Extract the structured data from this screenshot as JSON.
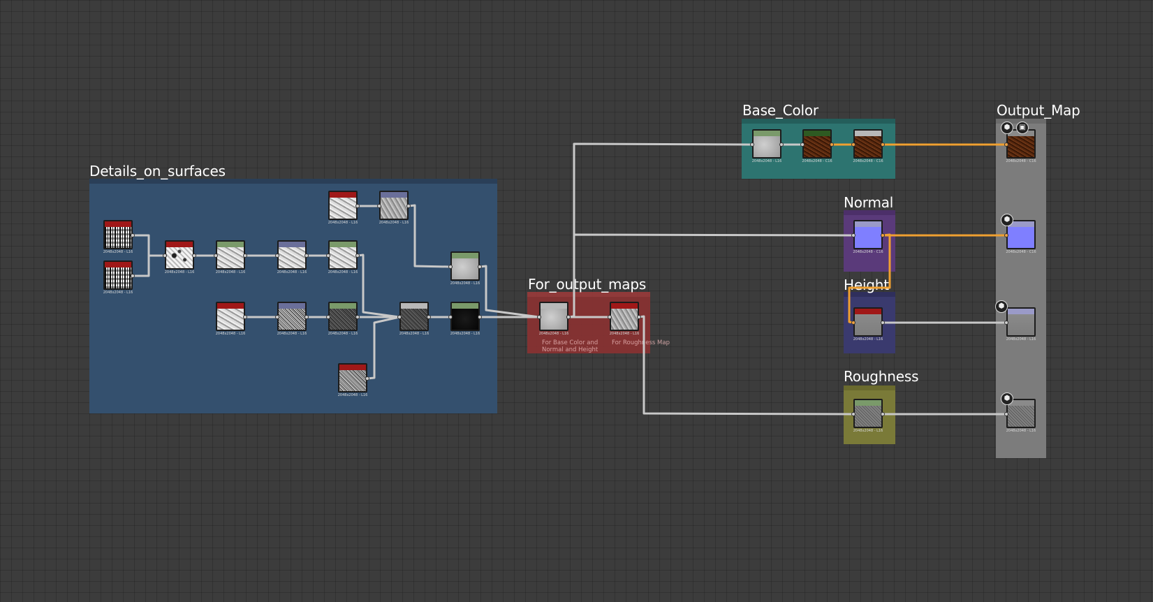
{
  "frames": {
    "details": {
      "title": "Details_on_surfaces",
      "color": "#34506e",
      "bar": "#2a3f58"
    },
    "for_output": {
      "title": "For_output_maps",
      "color": "#8b3232",
      "bar": "#9a3a3a",
      "comment_left": "For Base Color and\nNormal and Height",
      "comment_right": "For Roughness Map"
    },
    "base_color": {
      "title": "Base_Color",
      "color": "#2d7470",
      "bar": "#245e5b"
    },
    "normal": {
      "title": "Normal",
      "color": "#5a3a7a",
      "bar": "#4c2f69"
    },
    "height": {
      "title": "Height",
      "color": "#3a3a6e",
      "bar": "#2f2f5c"
    },
    "roughness": {
      "title": "Roughness",
      "color": "#7a7a38",
      "bar": "#6a6a2e"
    },
    "output": {
      "title": "Output_Map",
      "color": "#7c7c7c",
      "bar": "#6c6c6c"
    }
  },
  "header_colors": {
    "red": "#a01818",
    "green": "#7a9a6a",
    "blue": "#6a6f9a",
    "grey": "#b8b8b8",
    "darkgreen": "#2e5a22",
    "lavender": "#9a9ac8",
    "none": "#8a8a8a"
  },
  "wire_colors": {
    "default": "#c8c8c8",
    "orange": "#f0a030"
  },
  "nodes": [
    {
      "id": "n1",
      "header": "red",
      "thumb": "t-noise-bw",
      "label": "2048x2048 - L16"
    },
    {
      "id": "n2",
      "header": "red",
      "thumb": "t-noise-bw",
      "label": "2048x2048 - L16"
    },
    {
      "id": "n3",
      "header": "red",
      "thumb": "t-white-spots",
      "label": "2048x2048 - L16"
    },
    {
      "id": "n4",
      "header": "green",
      "thumb": "t-grey-light",
      "label": "2048x2048 - L16"
    },
    {
      "id": "n5",
      "header": "blue",
      "thumb": "t-grey-light",
      "label": "2048x2048 - L16"
    },
    {
      "id": "n6",
      "header": "green",
      "thumb": "t-grey-light",
      "label": "2048x2048 - L16"
    },
    {
      "id": "n7",
      "header": "red",
      "thumb": "t-grey-light",
      "label": "2048x2048 - L16"
    },
    {
      "id": "n8",
      "header": "blue",
      "thumb": "t-grey-mid",
      "label": "2048x2048 - L16"
    },
    {
      "id": "n9",
      "header": "green",
      "thumb": "t-grey-smooth",
      "label": "2048x2048 - L16"
    },
    {
      "id": "n10",
      "header": "red",
      "thumb": "t-grey-light",
      "label": "2048x2048 - L16"
    },
    {
      "id": "n11",
      "header": "blue",
      "thumb": "t-speckle",
      "label": "2048x2048 - L16"
    },
    {
      "id": "n12",
      "header": "green",
      "thumb": "t-dark-speckle",
      "label": "2048x2048 - L16"
    },
    {
      "id": "n13",
      "header": "grey",
      "thumb": "t-dark-speckle",
      "label": "2048x2048 - L16"
    },
    {
      "id": "n14",
      "header": "green",
      "thumb": "t-black",
      "label": "2048x2048 - L16"
    },
    {
      "id": "n15",
      "header": "red",
      "thumb": "t-speckle",
      "label": "2048x2048 - L16"
    },
    {
      "id": "n16",
      "header": "grey",
      "thumb": "t-grey-smooth",
      "label": "2048x2048 - L16"
    },
    {
      "id": "n17",
      "header": "red",
      "thumb": "t-grey-mid",
      "label": "2048x2048 - L16"
    },
    {
      "id": "n18",
      "header": "green",
      "thumb": "t-grey-smooth",
      "label": "2048x2048 - L16"
    },
    {
      "id": "n19",
      "header": "darkgreen",
      "thumb": "t-brown",
      "label": "2048x2048 - C16"
    },
    {
      "id": "n20",
      "header": "grey",
      "thumb": "t-brown",
      "label": "2048x2048 - C16"
    },
    {
      "id": "n21",
      "header": "none",
      "thumb": "t-brown",
      "label": "2048x2048 - C16"
    },
    {
      "id": "n22",
      "header": "lavender",
      "thumb": "t-blue",
      "label": "2048x2048 - C16"
    },
    {
      "id": "n23",
      "header": "lavender",
      "thumb": "t-blue",
      "label": "2048x2048 - C16"
    },
    {
      "id": "n24",
      "header": "red",
      "thumb": "t-grey-height",
      "label": "2048x2048 - L16"
    },
    {
      "id": "n25",
      "header": "lavender",
      "thumb": "t-grey-height",
      "label": "2048x2048 - L16"
    },
    {
      "id": "n26",
      "header": "green",
      "thumb": "t-grey-rough",
      "label": "2048x2048 - L16"
    },
    {
      "id": "n27",
      "header": "none",
      "thumb": "t-grey-rough",
      "label": "2048x2048 - L16"
    }
  ],
  "output_badges": [
    {
      "icon": "cube-icon",
      "glyph": "⬢"
    },
    {
      "icon": "checker-icon",
      "glyph": "▣"
    },
    {
      "icon": "cube-icon",
      "glyph": "⬢"
    },
    {
      "icon": "cube-icon",
      "glyph": "⬢"
    },
    {
      "icon": "cube-icon",
      "glyph": "⬢"
    }
  ]
}
